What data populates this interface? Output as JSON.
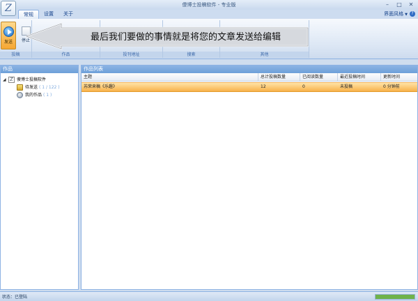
{
  "window": {
    "title": "傻博士投稿软件 - 专业版",
    "controls": {
      "minimize": "–",
      "maximize": "□",
      "close": "✕"
    }
  },
  "tabs": [
    {
      "label": "常规",
      "active": true
    },
    {
      "label": "设置",
      "active": false
    },
    {
      "label": "关于",
      "active": false
    }
  ],
  "theme_menu": {
    "label": "界面风格",
    "help": "?"
  },
  "ribbon": {
    "groups": [
      "投稿",
      "作品",
      "投刊地址",
      "搜索",
      "其他"
    ],
    "buttons": {
      "send": "发送",
      "stop": "停止"
    }
  },
  "callout": {
    "text": "最后我们要做的事情就是将您的文章发送给编辑"
  },
  "left_panel": {
    "title": "作品",
    "tree": {
      "root": "傻博士投稿软件",
      "children": [
        {
          "label": "待发送",
          "count": "( 1 / 122 )"
        },
        {
          "label": "我的作品",
          "count": "( 1 )"
        }
      ]
    }
  },
  "right_panel": {
    "title": "作品列表",
    "columns": [
      "主题",
      "总计投稿数量",
      "已阅读数量",
      "最近投稿时间",
      "更新时间"
    ],
    "rows": [
      {
        "subject": "苏荣来稿《乐趣》",
        "total": "12",
        "read": "0",
        "recent": "未投稿",
        "updated": "0 分钟前"
      }
    ]
  },
  "status": {
    "text": "状态：已登陆",
    "progress": 100
  },
  "colors": {
    "accent": "#f8b24a",
    "header": "#6d9fd9",
    "frame": "#8db2e3"
  }
}
